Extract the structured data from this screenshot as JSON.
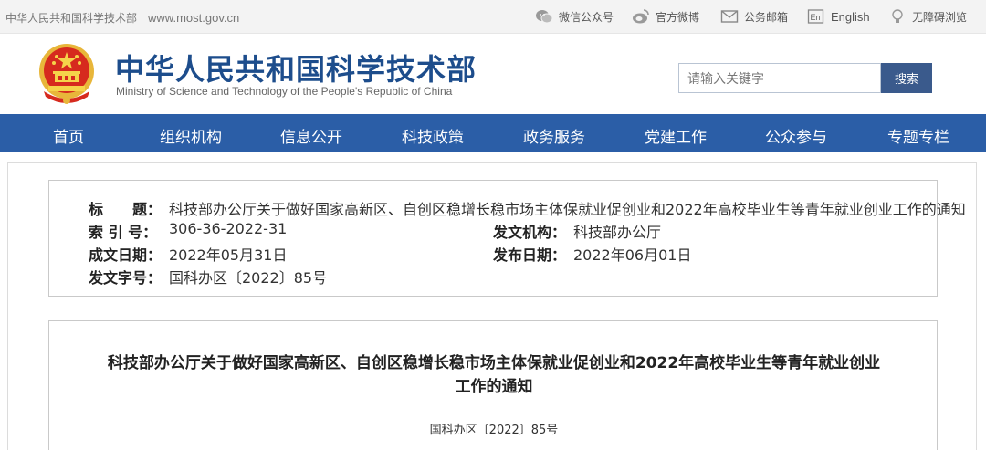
{
  "topbar": {
    "site_name": "中华人民共和国科学技术部",
    "site_url": "www.most.gov.cn",
    "links": [
      {
        "label": "微信公众号",
        "icon": "wechat-icon"
      },
      {
        "label": "官方微博",
        "icon": "weibo-icon"
      },
      {
        "label": "公务邮箱",
        "icon": "mail-icon"
      },
      {
        "label": "English",
        "icon": "english-icon"
      },
      {
        "label": "无障碍浏览",
        "icon": "accessibility-icon"
      }
    ]
  },
  "header": {
    "title_cn": "中华人民共和国科学技术部",
    "title_en": "Ministry of Science and Technology of the People's Republic of China",
    "search_placeholder": "请输入关键字",
    "search_button": "搜索"
  },
  "nav": {
    "items": [
      "首页",
      "组织机构",
      "信息公开",
      "科技政策",
      "政务服务",
      "党建工作",
      "公众参与",
      "专题专栏"
    ]
  },
  "meta": {
    "title_label": "标　　题：",
    "title_value": "科技部办公厅关于做好国家高新区、自创区稳增长稳市场主体保就业促创业和2022年高校毕业生等青年就业创业工作的通知",
    "index_label": "索 引 号：",
    "index_value": "306-36-2022-31",
    "issuer_label": "发文机构：",
    "issuer_value": "科技部办公厅",
    "written_label": "成文日期：",
    "written_value": "2022年05月31日",
    "published_label": "发布日期：",
    "published_value": "2022年06月01日",
    "docno_label": "发文字号：",
    "docno_value": "国科办区〔2022〕85号"
  },
  "document": {
    "title_line1": "科技部办公厅关于做好国家高新区、自创区稳增长稳市场主体保就业促创业和2022年高校毕业生等青年就业创业",
    "title_line2": "工作的通知",
    "doc_number": "国科办区〔2022〕85号"
  },
  "colors": {
    "nav_bg": "#2b5ea7",
    "title_blue": "#1d4d8c",
    "search_button_bg": "#3a5a8c"
  }
}
